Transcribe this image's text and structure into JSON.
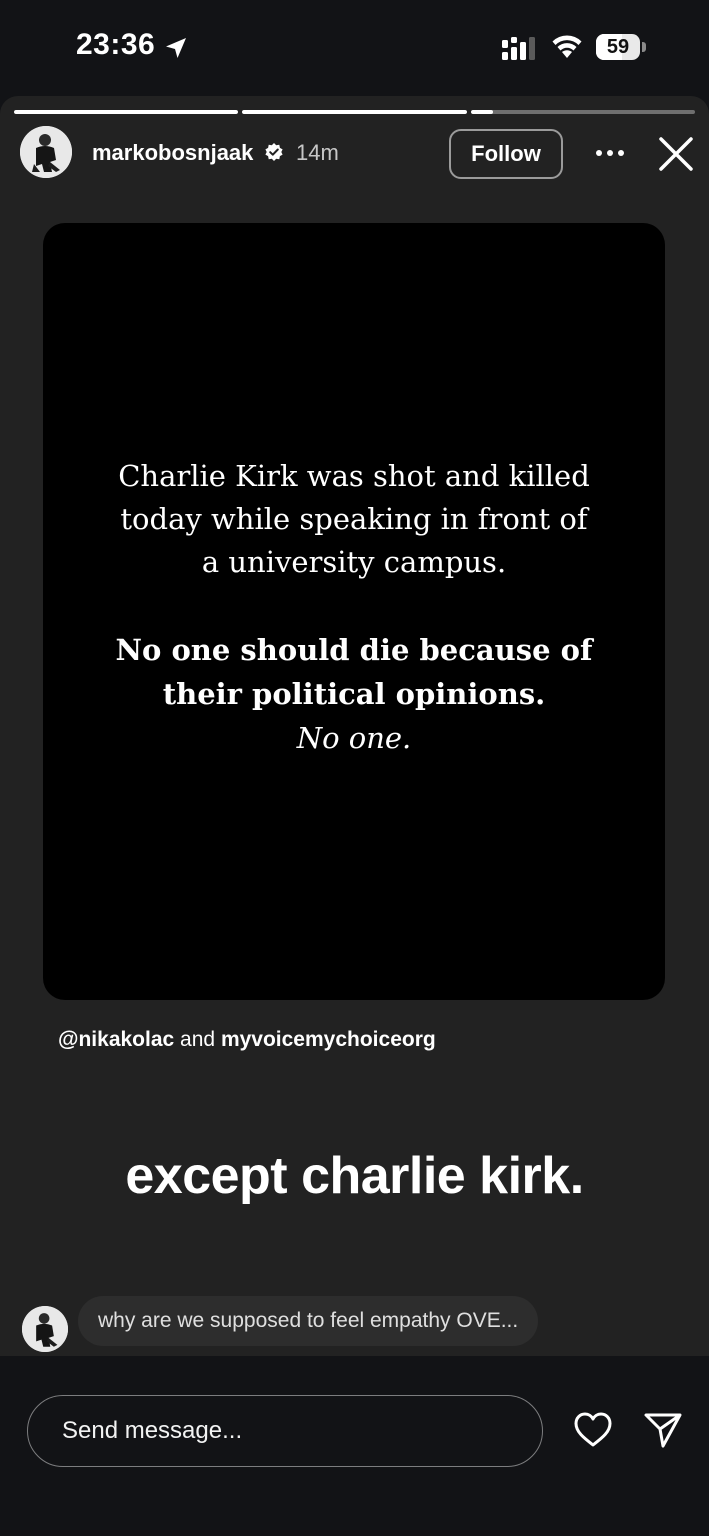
{
  "status_bar": {
    "time": "23:36",
    "battery_percent": "59",
    "battery_level": 0.59,
    "icons": [
      "location-arrow-icon",
      "cellular-signal-icon",
      "wifi-icon",
      "battery-icon"
    ]
  },
  "story": {
    "progress_segments": [
      1.0,
      1.0,
      0.1
    ],
    "header": {
      "username": "markobosnjaak",
      "verified": true,
      "time_ago": "14m",
      "follow_label": "Follow"
    },
    "post": {
      "line1": "Charlie Kirk was shot and killed today while speaking in front of a university campus.",
      "line2": "No one should die because of their political opinions.",
      "line3": "No one."
    },
    "mentions": {
      "first": "@nikakolac",
      "connector": "and",
      "second": "myvoicemychoiceorg"
    },
    "caption": "except charlie kirk.",
    "reply_preview": "why are we supposed to feel empathy OVE..."
  },
  "bottom_bar": {
    "message_placeholder": "Send message..."
  },
  "colors": {
    "story_bg": "#222222",
    "post_bg": "#000000",
    "app_bg": "#121316"
  }
}
